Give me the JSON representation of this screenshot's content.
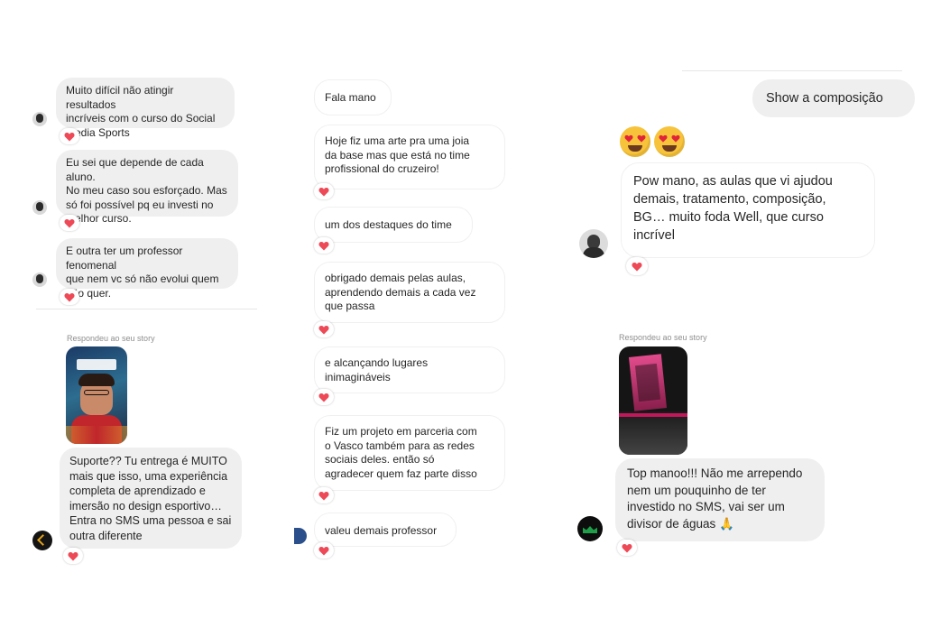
{
  "col1": {
    "messages": [
      "Muito difícil não atingir resultados\nincríveis com o curso do Social\nMedia Sports",
      "Eu sei que depende de cada aluno.\nNo meu caso sou esforçado. Mas\nsó foi possível pq eu investi no\nmelhor curso.",
      "E outra ter um professor fenomenal\nque nem vc só não evolui quem\nnão quer."
    ],
    "story_label": "Respondeu ao seu story",
    "reply": "Suporte?? Tu entrega é MUITO\nmais que isso, uma experiência\ncompleta de aprendizado e\nimersão no design esportivo…\nEntra no SMS uma pessoa e sai\noutra diferente"
  },
  "col2": {
    "messages": [
      "Fala mano",
      "Hoje fiz uma arte pra uma joia\nda base mas que está no time\nprofissional do cruzeiro!",
      "um dos destaques do time",
      "obrigado demais pelas aulas,\naprendendo demais a cada vez\nque passa",
      "e alcançando lugares\ninimagináveis",
      "Fiz um projeto em parceria com\no Vasco também para as redes\nsociais deles. então só\nagradecer quem faz parte disso",
      "valeu demais professor"
    ]
  },
  "col3": {
    "sent": "Show a composição",
    "emoji_name": "heart-eyes-emoji",
    "message": "Pow mano, as aulas que vi ajudou\ndemais, tratamento, composição,\nBG… muito foda Well, que curso\nincrível",
    "story_label": "Respondeu ao seu story",
    "reply": "Top manoo!!! Não me arrependo\nnem um pouquinho de ter\ninvestido no SMS, vai ser um\ndivisor de águas 🙏"
  },
  "colors": {
    "bubble": "#efefef",
    "heart": "#ed4956",
    "meta": "#8e8e8e"
  }
}
